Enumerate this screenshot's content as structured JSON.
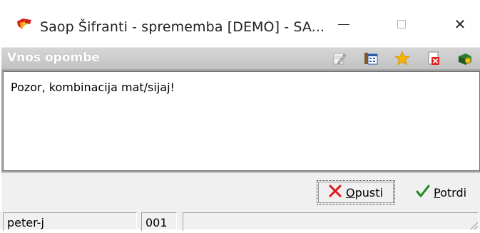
{
  "window": {
    "title": "Saop  Šifranti  - sprememba [DEMO] - SA...",
    "app_icon": "saop-app-icon",
    "controls": {
      "minimize": "minimize-icon",
      "maximize": "maximize-icon",
      "close": "close-icon"
    },
    "close_glyph": "✕"
  },
  "header": {
    "title": "Vnos opombe",
    "toolbar_icons": [
      "edit-icon",
      "calendar-icon",
      "star-icon",
      "delete-icon",
      "exit-icon"
    ]
  },
  "memo": {
    "value": "Pozor, kombinacija mat/sijaj!"
  },
  "buttons": {
    "cancel": {
      "hotkey": "O",
      "rest": "pusti",
      "icon": "red-x-icon"
    },
    "confirm": {
      "hotkey": "P",
      "rest": "otrdi",
      "icon": "green-check-icon"
    }
  },
  "statusbar": {
    "user": "peter-j",
    "code": "001",
    "extra": ""
  },
  "colors": {
    "header_text": "#ffffff",
    "header_bg": "#c8c8c8",
    "cancel_x": "#e0151a",
    "confirm_check": "#1c8a1c",
    "star": "#f5b400"
  }
}
